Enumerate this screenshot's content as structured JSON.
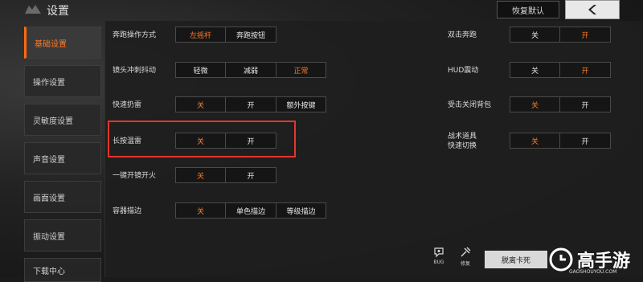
{
  "header": {
    "title": "设置",
    "restore_label": "恢复默认"
  },
  "sidebar": {
    "items": [
      {
        "label": "基础设置",
        "active": true
      },
      {
        "label": "操作设置",
        "active": false
      },
      {
        "label": "灵敏度设置",
        "active": false
      },
      {
        "label": "声音设置",
        "active": false
      },
      {
        "label": "画面设置",
        "active": false
      },
      {
        "label": "振动设置",
        "active": false
      },
      {
        "label": "下载中心",
        "active": false
      }
    ]
  },
  "settings_left": [
    {
      "label": "奔跑操作方式",
      "options": [
        "左摇杆",
        "奔跑按钮"
      ],
      "selected": 0
    },
    {
      "label": "镜头冲刺抖动",
      "options": [
        "轻微",
        "减弱",
        "正常"
      ],
      "selected": 2
    },
    {
      "label": "快速扔雷",
      "options": [
        "关",
        "开",
        "额外按键"
      ],
      "selected": 0
    },
    {
      "label": "长按温雷",
      "options": [
        "关",
        "开"
      ],
      "selected": 0
    },
    {
      "label": "一键开镜开火",
      "options": [
        "关",
        "开"
      ],
      "selected": 0
    },
    {
      "label": "容器描边",
      "options": [
        "关",
        "单色描边",
        "等级描边"
      ],
      "selected": 0
    }
  ],
  "settings_right": [
    {
      "label": "双击奔跑",
      "options": [
        "关",
        "开"
      ],
      "selected": 1
    },
    {
      "label": "HUD震动",
      "options": [
        "关",
        "开"
      ],
      "selected": 1
    },
    {
      "label": "受击关闭背包",
      "options": [
        "关",
        "开"
      ],
      "selected": 0
    },
    {
      "label_line1": "战术道具",
      "label_line2": "快速切换",
      "options": [
        "关",
        "开"
      ],
      "selected": 0
    }
  ],
  "tools": {
    "bug_label": "BUG",
    "repair_label": "修复",
    "escape_label": "脱离卡死"
  },
  "brand": {
    "name": "高手游",
    "url": "GAOSHOUYOU.COM"
  },
  "colors": {
    "accent": "#ff7a24",
    "highlight": "#e3362b"
  }
}
